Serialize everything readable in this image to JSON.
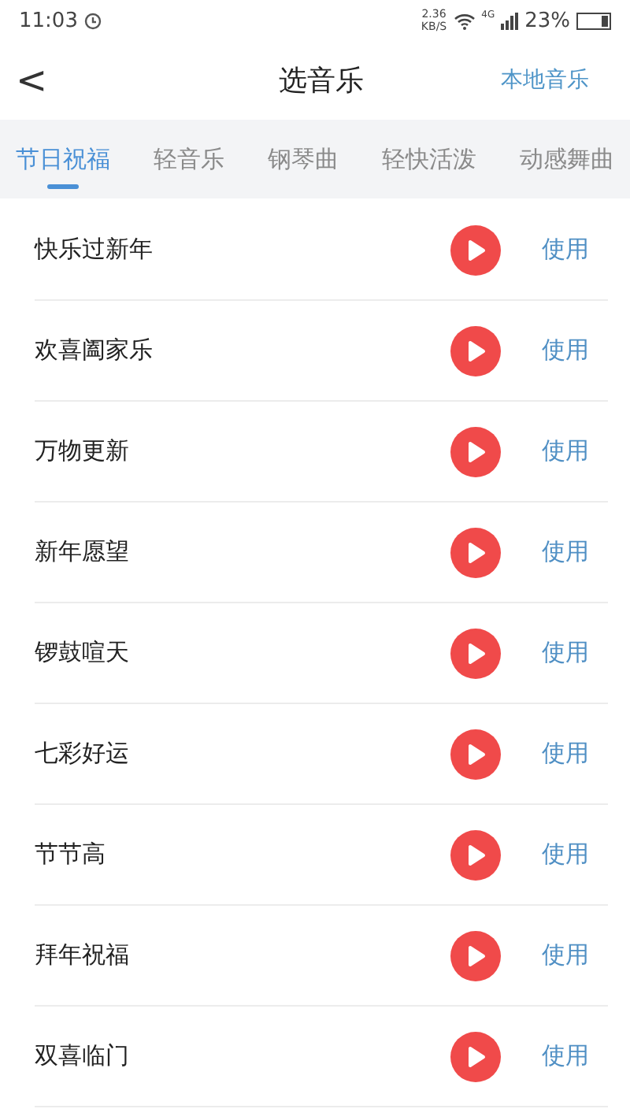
{
  "status_bar": {
    "time": "11:03",
    "speed": "2.36",
    "speed_unit": "KB/S",
    "network": "4G",
    "battery": "23%"
  },
  "header": {
    "back": "<",
    "title": "选音乐",
    "action": "本地音乐"
  },
  "tabs": [
    {
      "label": "节日祝福",
      "selected": true
    },
    {
      "label": "轻音乐",
      "selected": false
    },
    {
      "label": "钢琴曲",
      "selected": false
    },
    {
      "label": "轻快活泼",
      "selected": false
    },
    {
      "label": "动感舞曲",
      "selected": false
    }
  ],
  "songs": [
    {
      "name": "快乐过新年",
      "button": "使用"
    },
    {
      "name": "欢喜阖家乐",
      "button": "使用"
    },
    {
      "name": "万物更新",
      "button": "使用"
    },
    {
      "name": "新年愿望",
      "button": "使用"
    },
    {
      "name": "锣鼓喧天",
      "button": "使用"
    },
    {
      "name": "七彩好运",
      "button": "使用"
    },
    {
      "name": "节节高",
      "button": "使用"
    },
    {
      "name": "拜年祝福",
      "button": "使用"
    },
    {
      "name": "双喜临门",
      "button": "使用"
    }
  ]
}
